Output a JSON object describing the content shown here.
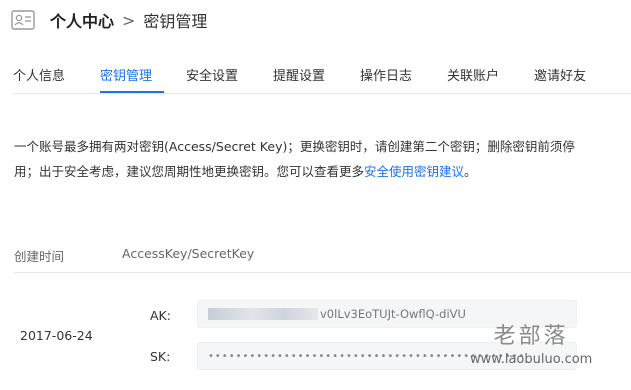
{
  "breadcrumb": {
    "root": "个人中心",
    "separator": ">",
    "current": "密钥管理"
  },
  "tabs": [
    {
      "label": "个人信息",
      "active": false
    },
    {
      "label": "密钥管理",
      "active": true
    },
    {
      "label": "安全设置",
      "active": false
    },
    {
      "label": "提醒设置",
      "active": false
    },
    {
      "label": "操作日志",
      "active": false
    },
    {
      "label": "关联账户",
      "active": false
    },
    {
      "label": "邀请好友",
      "active": false
    }
  ],
  "notice": {
    "text": "一个账号最多拥有两对密钥(Access/Secret Key)；更换密钥时，请创建第二个密钥；删除密钥前须停用；出于安全考虑，建议您周期性地更换密钥。您可以查看更多",
    "link_text": "安全使用密钥建议",
    "end": "。"
  },
  "table": {
    "headers": [
      "创建时间",
      "AccessKey/SecretKey"
    ],
    "rows": [
      {
        "created": "2017-06-24",
        "ak_label": "AK:",
        "ak_value": "v0lLv3EoTUJt-OwflQ-diVU",
        "sk_label": "SK:",
        "sk_value": "••••••••••••••••••••••••••••••••••••••••••••••"
      }
    ]
  },
  "watermark": {
    "name": "老部落",
    "url": "www.laobuluo.com"
  },
  "colors": {
    "accent": "#1a73e8",
    "text": "#333333",
    "muted": "#666666",
    "divider": "#e8e8e8"
  }
}
